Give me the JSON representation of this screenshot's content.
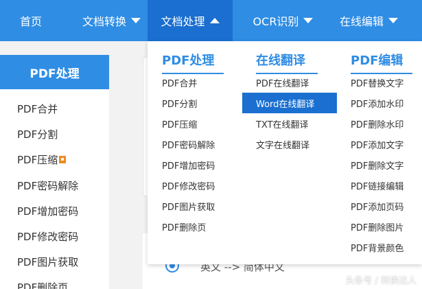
{
  "nav": {
    "home": "首页",
    "doc_convert": "文档转换",
    "doc_process": "文档处理",
    "ocr": "OCR识别",
    "online_edit": "在线编辑"
  },
  "sidebar": {
    "title": "PDF处理",
    "items": [
      "PDF合并",
      "PDF分割",
      "PDF压缩",
      "PDF密码解除",
      "PDF增加密码",
      "PDF修改密码",
      "PDF图片获取",
      "PDF删除页"
    ]
  },
  "dropdown": {
    "pdf_process": {
      "title": "PDF处理",
      "items": [
        "PDF合并",
        "PDF分割",
        "PDF压缩",
        "PDF密码解除",
        "PDF增加密码",
        "PDF修改密码",
        "PDF图片获取",
        "PDF删除页"
      ]
    },
    "online_translate": {
      "title": "在线翻译",
      "items": [
        "PDF在线翻译",
        "Word在线翻译",
        "TXT在线翻译",
        "文字在线翻译"
      ],
      "highlighted_index": 1
    },
    "pdf_edit": {
      "title": "PDF编辑",
      "items": [
        "PDF替换文字",
        "PDF添加水印",
        "PDF删除水印",
        "PDF添加文字",
        "PDF删除文字",
        "PDF链接编辑",
        "PDF添加页码",
        "PDF删除图片",
        "PDF背景颜色"
      ]
    }
  },
  "content": {
    "radio_label": "英文 --> 简体中文"
  },
  "watermark": "头条号 / 转换达人",
  "colors": {
    "primary": "#2f8de4",
    "active": "#1a6fd0",
    "hot_badge": "#f08a24"
  },
  "icons": {
    "caret_down": "chevron-down-icon",
    "caret_up": "chevron-up-icon",
    "hot": "hot-badge-icon",
    "radio": "radio-selected-icon"
  }
}
